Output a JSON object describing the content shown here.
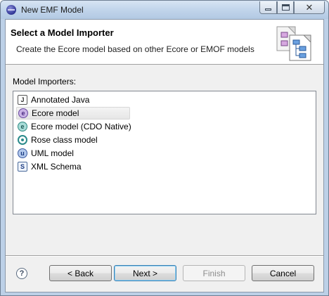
{
  "window": {
    "title": "New EMF Model"
  },
  "banner": {
    "title": "Select a Model Importer",
    "description": "Create the Ecore model based on other Ecore or EMOF models"
  },
  "importers": {
    "label": "Model Importers:",
    "selected": "Ecore model",
    "items": [
      {
        "label": "Annotated Java",
        "icon": "java-file-icon"
      },
      {
        "label": "Ecore model",
        "icon": "ecore-icon"
      },
      {
        "label": "Ecore model (CDO Native)",
        "icon": "cdo-ecore-icon"
      },
      {
        "label": "Rose class model",
        "icon": "rose-icon"
      },
      {
        "label": "UML model",
        "icon": "uml-icon"
      },
      {
        "label": "XML Schema",
        "icon": "xml-schema-icon"
      }
    ]
  },
  "buttons": {
    "help": "?",
    "back": "< Back",
    "next": "Next >",
    "finish": "Finish",
    "cancel": "Cancel"
  },
  "colors": {
    "selection": "#e6e6e6",
    "default_button_border": "#3c7fb1",
    "disabled_text": "#8d8d8d"
  }
}
